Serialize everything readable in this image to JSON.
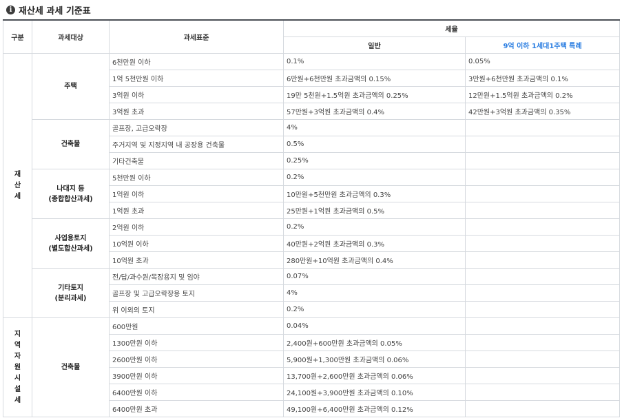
{
  "title": "재산세 과세 기준표",
  "headers": {
    "division": "구분",
    "target": "과세대상",
    "standard": "과세표준",
    "rate": "세율",
    "general": "일반",
    "special": "9억 이하 1세대1주택 특례"
  },
  "groups": [
    {
      "name": "재산세",
      "categories": [
        {
          "name": "주택",
          "rows": [
            {
              "std": "6천만원 이하",
              "gen": "0.1%",
              "spc": "0.05%"
            },
            {
              "std": "1억 5천만원 이하",
              "gen": "6만원+6천만원 초과금액의 0.15%",
              "spc": "3만원+6천만원 초과금액의 0.1%"
            },
            {
              "std": "3억원 이하",
              "gen": "19만 5천원+1.5억원 초과금액의 0.25%",
              "spc": "12만원+1.5억원 초과금액의 0.2%"
            },
            {
              "std": "3억원 초과",
              "gen": "57만원+3억원 초과금액의 0.4%",
              "spc": "42만원+3억원 초과금액의 0.35%"
            }
          ]
        },
        {
          "name": "건축물",
          "rows": [
            {
              "std": "골프장, 고급오락장",
              "gen": "4%",
              "spc": ""
            },
            {
              "std": "주거지역 및 지정지역 내 공장용 건축물",
              "gen": "0.5%",
              "spc": ""
            },
            {
              "std": "기타건축물",
              "gen": "0.25%",
              "spc": ""
            }
          ]
        },
        {
          "name": "나대지 등",
          "sub": "(종합합산과세)",
          "rows": [
            {
              "std": "5천만원 이하",
              "gen": "0.2%",
              "spc": ""
            },
            {
              "std": "1억원 이하",
              "gen": "10만원+5천만원 초과금액의 0.3%",
              "spc": ""
            },
            {
              "std": "1억원 초과",
              "gen": "25만원+1억원 초과금액의 0.5%",
              "spc": ""
            }
          ]
        },
        {
          "name": "사업용토지",
          "sub": "(별도합산과세)",
          "rows": [
            {
              "std": "2억원 이하",
              "gen": "0.2%",
              "spc": ""
            },
            {
              "std": "10억원 이하",
              "gen": "40만원+2억원 초과금액의 0.3%",
              "spc": ""
            },
            {
              "std": "10억원 초과",
              "gen": "280만원+10억원 초과금액의 0.4%",
              "spc": ""
            }
          ]
        },
        {
          "name": "기타토지",
          "sub": "(분리과세)",
          "rows": [
            {
              "std": "전/답/과수원/목장용지 및 임야",
              "gen": "0.07%",
              "spc": ""
            },
            {
              "std": "골프장 및 고급오락장용 토지",
              "gen": "4%",
              "spc": ""
            },
            {
              "std": "위 이외의 토지",
              "gen": "0.2%",
              "spc": ""
            }
          ]
        }
      ]
    },
    {
      "name": "지역자원시설세",
      "categories": [
        {
          "name": "건축물",
          "rows": [
            {
              "std": "600만원",
              "gen": "0.04%",
              "spc": ""
            },
            {
              "std": "1300만원 이하",
              "gen": "2,400원+600만원 초과금액의 0.05%",
              "spc": ""
            },
            {
              "std": "2600만원 이하",
              "gen": "5,900원+1,300만원 초과금액의 0.06%",
              "spc": ""
            },
            {
              "std": "3900만원 이하",
              "gen": "13,700원+2,600만원 초과금액의 0.06%",
              "spc": ""
            },
            {
              "std": "6400만원 이하",
              "gen": "24,100원+3,900만원 초과금액의 0.10%",
              "spc": ""
            },
            {
              "std": "6400만원 초과",
              "gen": "49,100원+6,400만원 초과금액의 0.12%",
              "spc": ""
            }
          ]
        }
      ]
    }
  ]
}
